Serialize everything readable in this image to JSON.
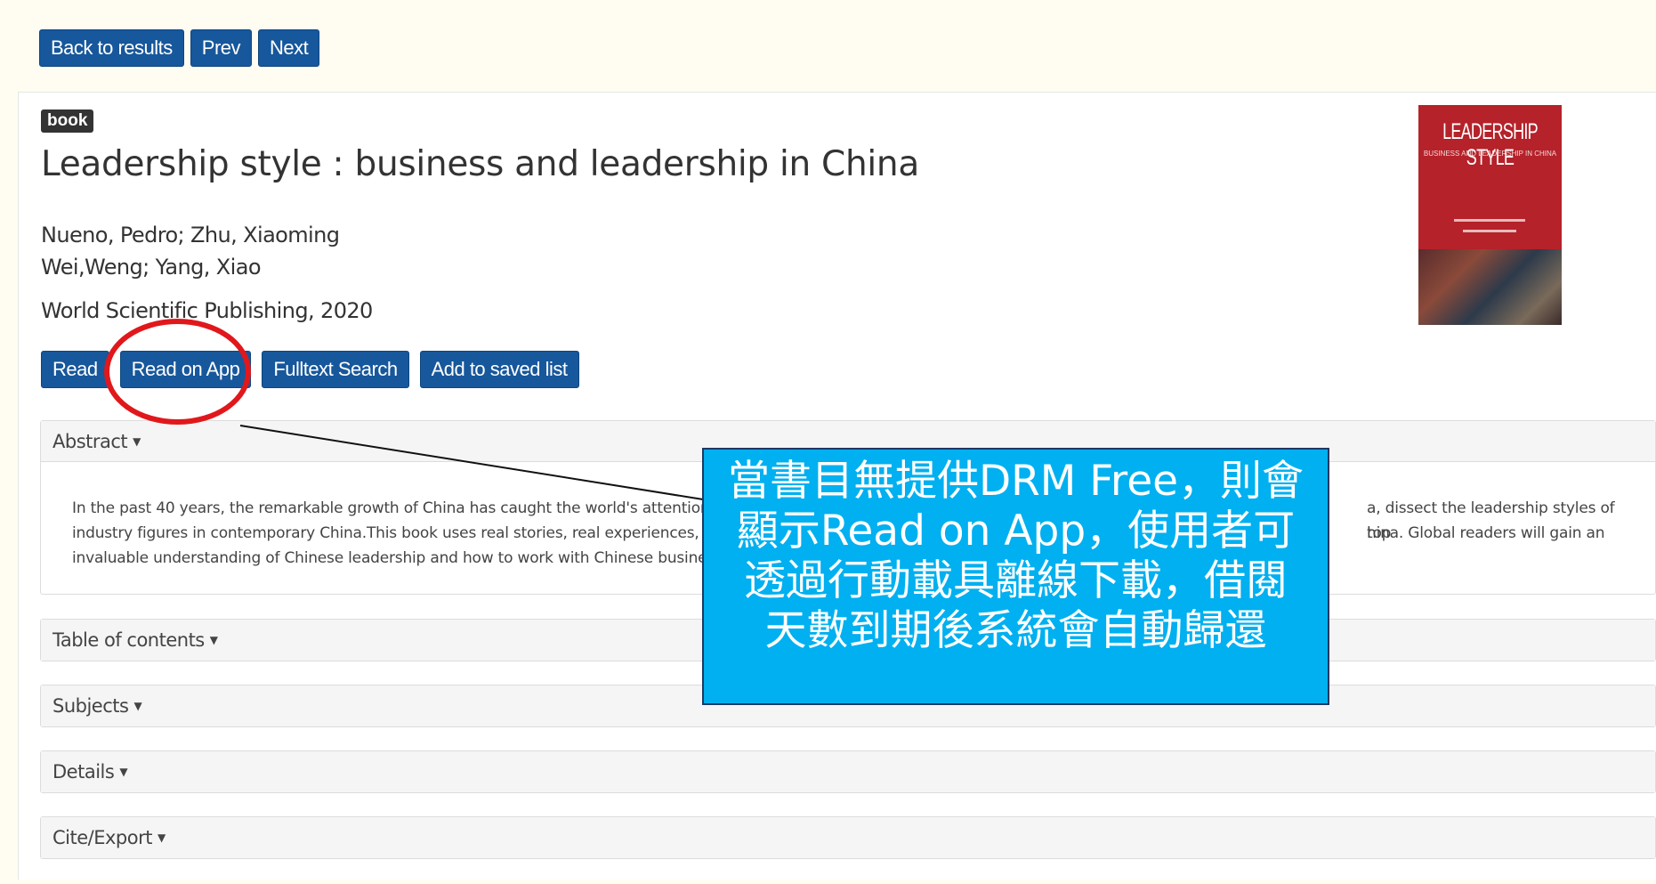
{
  "nav": {
    "back_label": "Back to results",
    "prev_label": "Prev",
    "next_label": "Next"
  },
  "record": {
    "type_badge": "book",
    "title": "Leadership style : business and leadership in China",
    "authors_line1": "Nueno, Pedro; Zhu, Xiaoming",
    "authors_line2": "Wei,Weng; Yang, Xiao",
    "publisher": "World Scientific Publishing, 2020"
  },
  "actions": {
    "read": "Read",
    "read_on_app": "Read on App",
    "fulltext_search": "Fulltext Search",
    "add_saved": "Add to saved list"
  },
  "cover": {
    "title": "LEADERSHIP STYLE",
    "subtitle": "BUSINESS AND LEADERSHIP IN CHINA"
  },
  "panels": {
    "abstract_label": "Abstract",
    "abstract_l1a": "In the past 40 years, the remarkable growth of China has caught the world's attention.",
    "abstract_l1b": "a, dissect the leadership styles of top",
    "abstract_l2a": "industry figures in contemporary China.This book uses real stories, real experiences, an",
    "abstract_l2b": "hina. Global readers will gain an",
    "abstract_l3a": "invaluable understanding of Chinese leadership and how to work with Chinese busines",
    "toc_label": "Table of contents",
    "subjects_label": "Subjects",
    "details_label": "Details",
    "cite_label": "Cite/Export"
  },
  "annotation": {
    "line1": "當書目無提供DRM Free，則會",
    "line2": "顯示Read on App，使用者可",
    "line3": "透過行動載具離線下載，借閱",
    "line4": "天數到期後系統會自動歸還",
    "fill_color": "#00b0f0",
    "ring_color": "#e0181c"
  },
  "colors": {
    "button": "#17579b",
    "page_bg": "#fdf6d8"
  }
}
